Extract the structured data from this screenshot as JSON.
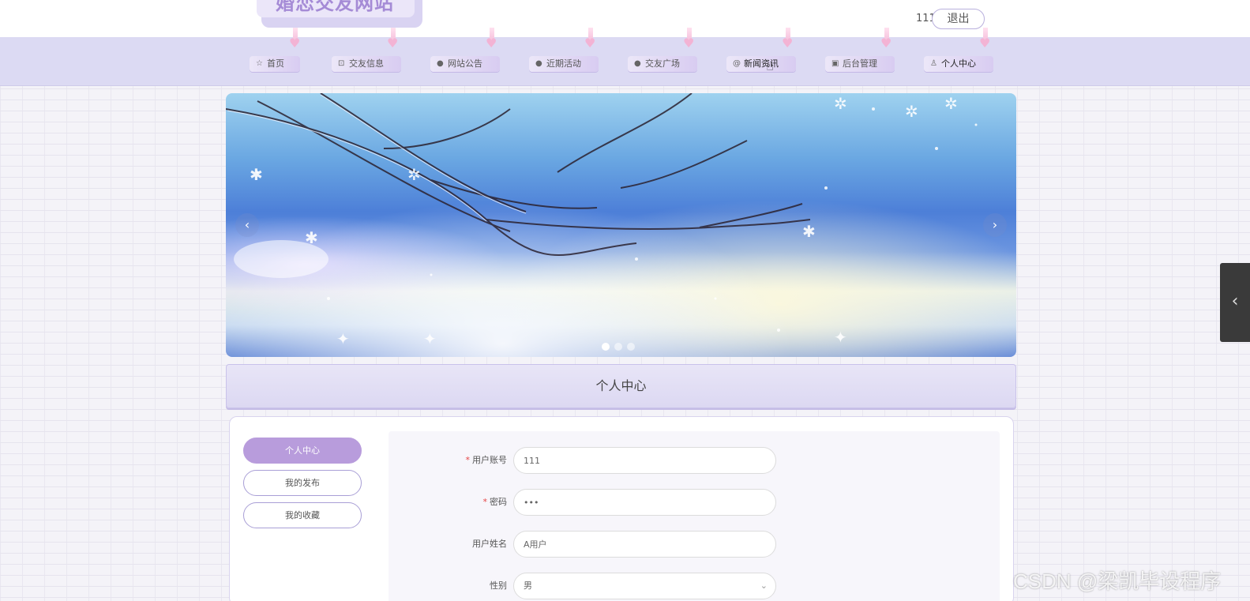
{
  "header": {
    "site_title": "婚恋交友网站",
    "username": "111",
    "logout_label": "退出"
  },
  "nav": {
    "items": [
      {
        "label": "首页",
        "icon": "star-icon",
        "glyph": "☆"
      },
      {
        "label": "交友信息",
        "icon": "lock-icon",
        "glyph": "🔒"
      },
      {
        "label": "网站公告",
        "icon": "info-icon",
        "glyph": "❶"
      },
      {
        "label": "近期活动",
        "icon": "question-icon",
        "glyph": "❓"
      },
      {
        "label": "交友广场",
        "icon": "info-circle-icon",
        "glyph": "ℹ"
      },
      {
        "label": "新闻资讯",
        "icon": "at-icon",
        "glyph": "@"
      },
      {
        "label": "后台管理",
        "icon": "briefcase-icon",
        "glyph": "▣"
      },
      {
        "label": "个人中心",
        "icon": "user-icon",
        "glyph": "👤"
      }
    ]
  },
  "carousel": {
    "prev_glyph": "‹",
    "next_glyph": "›",
    "slide_count": 3,
    "active_index": 0
  },
  "section": {
    "title": "个人中心"
  },
  "sidebar": {
    "items": [
      {
        "label": "个人中心",
        "active": true
      },
      {
        "label": "我的发布",
        "active": false
      },
      {
        "label": "我的收藏",
        "active": false
      }
    ]
  },
  "form": {
    "account": {
      "label": "用户账号",
      "required": true,
      "value": "111"
    },
    "password": {
      "label": "密码",
      "required": true,
      "value": "•••"
    },
    "name": {
      "label": "用户姓名",
      "required": false,
      "value": "A用户"
    },
    "gender": {
      "label": "性别",
      "required": false,
      "value": "男"
    }
  },
  "floating_tab": {
    "glyph": "‹"
  },
  "watermark": "CSDN @梁凯毕设程序",
  "colors": {
    "accent": "#b89cdc",
    "nav_bg": "#dcdaf3",
    "title": "#a58bd6"
  }
}
